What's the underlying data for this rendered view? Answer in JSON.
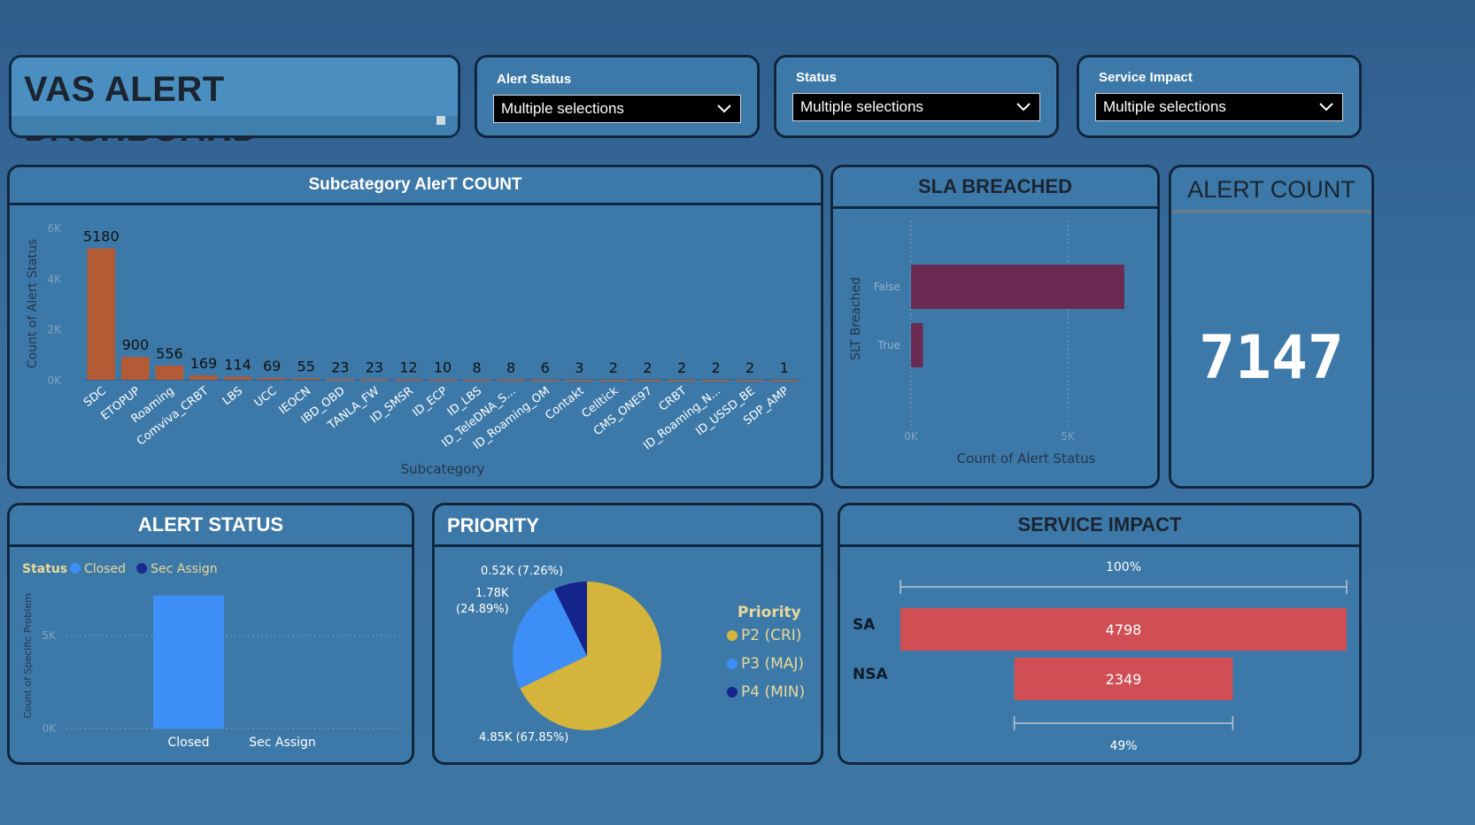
{
  "header": {
    "title": "VAS ALERT DASHBOARD"
  },
  "slicers": [
    {
      "label": "Alert Status",
      "value": "Multiple selections"
    },
    {
      "label": "Status",
      "value": "Multiple selections"
    },
    {
      "label": "Service Impact",
      "value": "Multiple selections"
    }
  ],
  "subcategory_panel": {
    "title": "Subcategory AlerT COUNT"
  },
  "sla_panel": {
    "title": "SLA BREACHED"
  },
  "alert_count": {
    "title": "ALERT COUNT",
    "value": "7147"
  },
  "alert_status_panel": {
    "title": "ALERT STATUS"
  },
  "priority_panel": {
    "title": "PRIORITY"
  },
  "service_impact_panel": {
    "title": "SERVICE IMPACT"
  },
  "chart_data": [
    {
      "type": "bar",
      "xlabel": "Subcategory",
      "ylabel": "Count of Alert Status",
      "ylim": [
        0,
        6000
      ],
      "yticks": [
        "0K",
        "2K",
        "4K",
        "6K"
      ],
      "categories": [
        "SDC",
        "ETOPUP",
        "Roaming",
        "Comviva_CRBT",
        "LBS",
        "UCC",
        "IEOCN",
        "IBD_OBD",
        "TANLA_FW",
        "ID_SMSR",
        "ID_ECP",
        "ID_LBS",
        "ID_TeleDNA_S...",
        "ID_Roaming_OM",
        "Contakt",
        "Celltick",
        "CMS_ONE97",
        "CRBT",
        "ID_Roaming_N...",
        "ID_USSD_BE",
        "SDP_AMP"
      ],
      "values": [
        5180,
        900,
        556,
        169,
        114,
        69,
        55,
        23,
        23,
        12,
        10,
        8,
        8,
        6,
        3,
        2,
        2,
        2,
        2,
        2,
        1
      ],
      "color": "#b35b35"
    },
    {
      "type": "bar",
      "orientation": "horizontal",
      "xlabel": "Count of Alert Status",
      "ylabel": "SLT Breached",
      "xlim": [
        0,
        7000
      ],
      "xticks": [
        "0K",
        "5K"
      ],
      "categories": [
        "False",
        "True"
      ],
      "values": [
        6800,
        380
      ],
      "color": "#6b2a52"
    },
    {
      "type": "bar",
      "ylabel": "Count of Specific Problem",
      "ylim": [
        0,
        8000
      ],
      "yticks": [
        "0K",
        "5K"
      ],
      "legend_title": "Status",
      "categories": [
        "Closed",
        "Sec Assign"
      ],
      "series": [
        {
          "name": "Closed",
          "color": "#3e8ef7",
          "values": [
            7147,
            0
          ]
        },
        {
          "name": "Sec Assign",
          "color": "#1a2a8f",
          "values": [
            0,
            0
          ]
        }
      ]
    },
    {
      "type": "pie",
      "legend_title": "Priority",
      "slices": [
        {
          "name": "P2 (CRI)",
          "value": 4850,
          "label": "4.85K (67.85%)",
          "color": "#d4b43a"
        },
        {
          "name": "P3 (MAJ)",
          "value": 1780,
          "label": "1.78K (24.89%)",
          "color": "#3e8ef7"
        },
        {
          "name": "P4 (MIN)",
          "value": 520,
          "label": "0.52K (7.26%)",
          "color": "#14248a"
        }
      ]
    },
    {
      "type": "bar",
      "orientation": "horizontal",
      "subtype": "funnel",
      "categories": [
        "SA",
        "NSA"
      ],
      "values": [
        4798,
        2349
      ],
      "top_label": "100%",
      "bottom_label": "49%",
      "color": "#cf4f55"
    }
  ]
}
